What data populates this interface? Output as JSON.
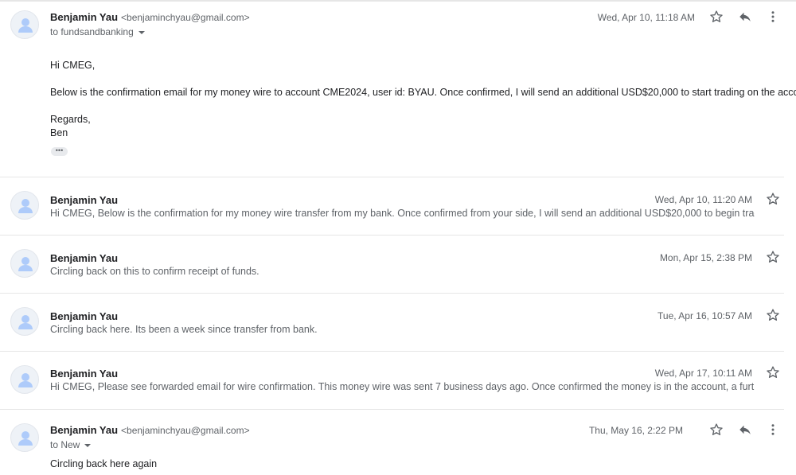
{
  "messages": [
    {
      "sender": "Benjamin Yau",
      "email": "<benjaminchyau@gmail.com>",
      "to": "to fundsandbanking",
      "date": "Wed, Apr 10, 11:18 AM",
      "body": [
        "Hi CMEG,",
        "Below is the confirmation email for my money wire to account CME2024, user id: BYAU. Once confirmed, I will send an additional USD$20,000 to start trading on the account.",
        "Regards,",
        "Ben"
      ],
      "ellipsis": "•••"
    },
    {
      "sender": "Benjamin Yau",
      "date": "Wed, Apr 10, 11:20 AM",
      "snippet": "Hi CMEG, Below is the confirmation for my money wire transfer from my bank. Once confirmed from your side, I will send an additional USD$20,000 to begin trading"
    },
    {
      "sender": "Benjamin Yau",
      "date": "Mon, Apr 15, 2:38 PM",
      "snippet": "Circling back on this to confirm receipt of funds."
    },
    {
      "sender": "Benjamin Yau",
      "date": "Tue, Apr 16, 10:57 AM",
      "snippet": "Circling back here. Its been a week since transfer from bank."
    },
    {
      "sender": "Benjamin Yau",
      "date": "Wed, Apr 17, 10:11 AM",
      "snippet": "Hi CMEG, Please see forwarded email for wire confirmation. This money wire was sent 7 business days ago. Once confirmed the money is in the account, a further $"
    },
    {
      "sender": "Benjamin Yau",
      "email": "<benjaminchyau@gmail.com>",
      "to": "to New",
      "date": "Thu, May 16, 2:22 PM",
      "body": [
        "Circling back here again"
      ]
    }
  ],
  "icons": {
    "star": "star-icon",
    "reply": "reply-icon",
    "more": "more-vert-icon",
    "avatar": "person-icon"
  },
  "colors": {
    "text": "#202124",
    "secondary": "#5f6368",
    "divider": "#e6e6e6",
    "avatar_fg": "#aecbfa"
  }
}
